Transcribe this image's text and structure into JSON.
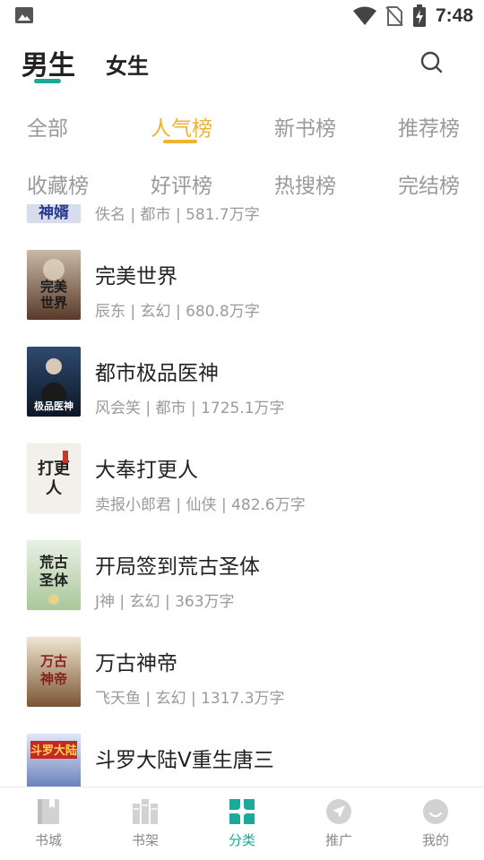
{
  "status_bar": {
    "time": "7:48"
  },
  "gender_tabs": [
    {
      "label": "男生",
      "active": true
    },
    {
      "label": "女生",
      "active": false
    }
  ],
  "rank_tabs": [
    {
      "label": "全部",
      "active": false
    },
    {
      "label": "人气榜",
      "active": true
    },
    {
      "label": "新书榜",
      "active": false
    },
    {
      "label": "推荐榜",
      "active": false
    },
    {
      "label": "收藏榜",
      "active": false
    },
    {
      "label": "好评榜",
      "active": false
    },
    {
      "label": "热搜榜",
      "active": false
    },
    {
      "label": "完结榜",
      "active": false
    }
  ],
  "books": [
    {
      "title": "",
      "meta": "佚名 | 都市 | 581.7万字",
      "cover_text": "神婿"
    },
    {
      "title": "完美世界",
      "meta": "辰东 | 玄幻 | 680.8万字",
      "cover_text": "完美世界"
    },
    {
      "title": "都市极品医神",
      "meta": "风会笑 | 都市 | 1725.1万字",
      "cover_text": "极品医神"
    },
    {
      "title": "大奉打更人",
      "meta": "卖报小郎君 | 仙侠 | 482.6万字",
      "cover_text": "打更人"
    },
    {
      "title": "开局签到荒古圣体",
      "meta": "J神 | 玄幻 | 363万字",
      "cover_text": "荒古圣体"
    },
    {
      "title": "万古神帝",
      "meta": "飞天鱼 | 玄幻 | 1317.3万字",
      "cover_text": "万古神帝"
    },
    {
      "title": "斗罗大陆V重生唐三",
      "meta": "",
      "cover_text": "斗罗大陆"
    }
  ],
  "bottom_nav": [
    {
      "label": "书城",
      "icon": "book-icon",
      "active": false
    },
    {
      "label": "书架",
      "icon": "bookshelf-icon",
      "active": false
    },
    {
      "label": "分类",
      "icon": "category-grid-icon",
      "active": true
    },
    {
      "label": "推广",
      "icon": "promote-arrow-icon",
      "active": false
    },
    {
      "label": "我的",
      "icon": "profile-smile-icon",
      "active": false
    }
  ],
  "colors": {
    "accent_teal": "#1aa99a",
    "accent_gold": "#f0b232"
  }
}
